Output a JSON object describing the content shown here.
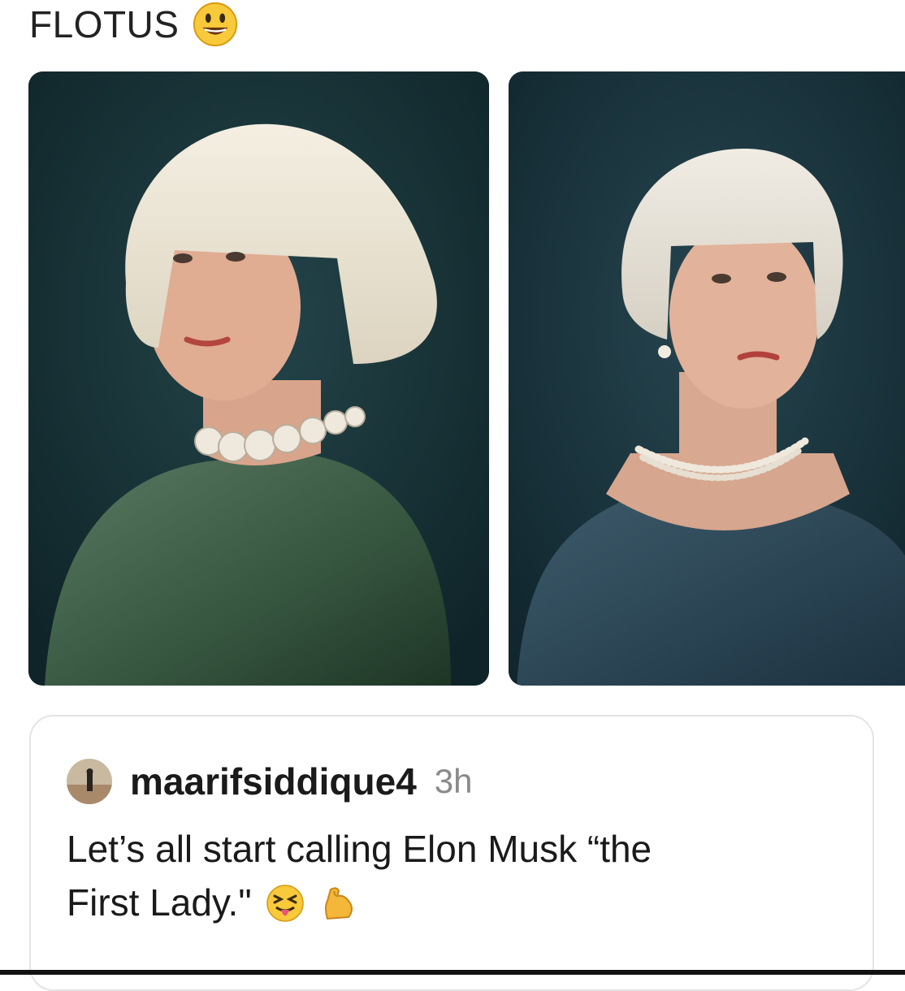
{
  "post": {
    "title": "FLOTUS",
    "title_emoji": "grinning-face-emoji"
  },
  "photos": [
    {
      "name": "portrait-left",
      "tint": "#163238",
      "garment": "#3f5e4a"
    },
    {
      "name": "portrait-right",
      "tint": "#1d343c",
      "garment": "#2e4a5a"
    }
  ],
  "comment": {
    "username": "maarifsiddique4",
    "time": "3h",
    "text_line1": "Let’s all start calling Elon Musk “the",
    "text_line2": "First Lady.\"",
    "emojis": [
      "squinting-face-with-tongue-emoji",
      "flexed-biceps-emoji"
    ]
  }
}
